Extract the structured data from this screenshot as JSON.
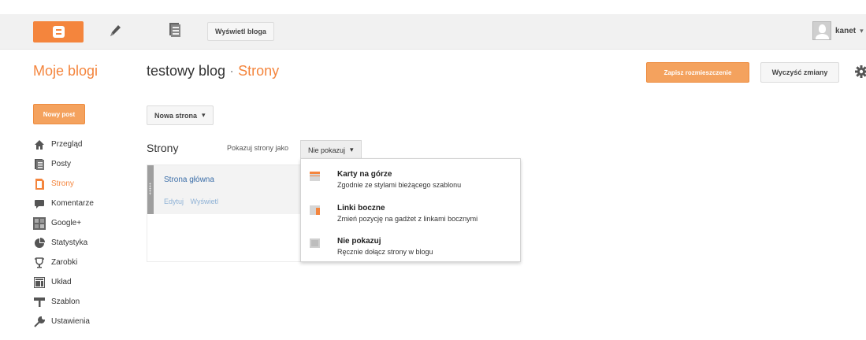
{
  "topbar": {
    "view_blog": "Wyświetl bloga",
    "username": "kanet",
    "user_caret": "▾"
  },
  "header": {
    "my_blogs": "Moje blogi",
    "blog_name": "testowy blog",
    "separator": "·",
    "section": "Strony",
    "save_button": "Zapisz rozmieszczenie",
    "clear_button": "Wyczyść zmiany"
  },
  "sidebar": {
    "new_post": "Nowy post",
    "items": [
      {
        "label": "Przegląd",
        "icon": "home-icon",
        "active": false
      },
      {
        "label": "Posty",
        "icon": "posts-icon",
        "active": false
      },
      {
        "label": "Strony",
        "icon": "pages-icon",
        "active": true
      },
      {
        "label": "Komentarze",
        "icon": "comment-icon",
        "active": false
      },
      {
        "label": "Google+",
        "icon": "google-plus-icon",
        "active": false
      },
      {
        "label": "Statystyka",
        "icon": "pie-chart-icon",
        "active": false
      },
      {
        "label": "Zarobki",
        "icon": "trophy-icon",
        "active": false
      },
      {
        "label": "Układ",
        "icon": "layout-icon",
        "active": false
      },
      {
        "label": "Szablon",
        "icon": "template-icon",
        "active": false
      },
      {
        "label": "Ustawienia",
        "icon": "wrench-icon",
        "active": false
      }
    ]
  },
  "main": {
    "new_page": "Nowa strona",
    "new_page_caret": "▾",
    "pages_title": "Strony",
    "show_as_label": "Pokazuj strony jako",
    "show_as_value": "Nie pokazuj",
    "show_as_caret": "▾",
    "pages": [
      {
        "name": "Strona główna",
        "edit": "Edytuj",
        "view": "Wyświetl"
      }
    ]
  },
  "menu": {
    "options": [
      {
        "title": "Karty na górze",
        "desc": "Zgodnie ze stylami bieżącego szablonu",
        "icon": "tabs-top-icon"
      },
      {
        "title": "Linki boczne",
        "desc": "Zmień pozycję na gadżet z linkami bocznymi",
        "icon": "side-links-icon"
      },
      {
        "title": "Nie pokazuj",
        "desc": "Ręcznie dołącz strony w blogu",
        "icon": "hidden-icon"
      }
    ]
  },
  "colors": {
    "accent": "#f4853d",
    "link": "#3b6ea8"
  }
}
